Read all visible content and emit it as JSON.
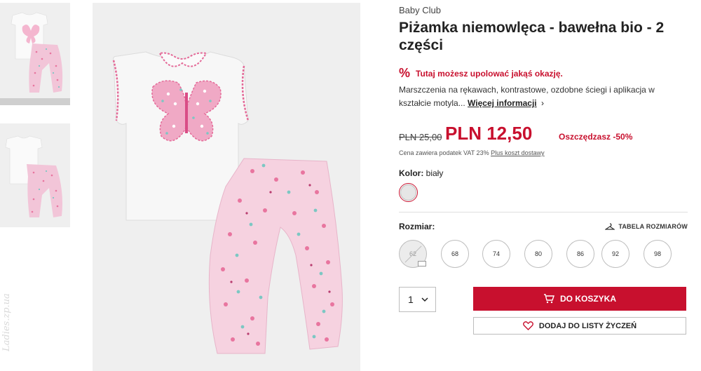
{
  "product": {
    "brand": "Baby Club",
    "title": "Piżamka niemowlęca - bawełna bio - 2 części",
    "promo_icon": "%",
    "promo_text": "Tutaj możesz upolować jakąś okazję.",
    "description": "Marszczenia na rękawach, kontrastowe, ozdobne ściegi i aplikacja w kształcie motyla...",
    "more_link": "Więcej informacji",
    "more_chevron": "›",
    "old_price": "PLN 25,00",
    "new_price": "PLN 12,50",
    "savings": "Oszczędzasz -50%",
    "vat_text": "Cena zawiera podatek VAT 23%",
    "shipping_link": "Plus koszt dostawy"
  },
  "color": {
    "label": "Kolor:",
    "value": "biały",
    "swatch_color": "#e6e6e6"
  },
  "sizes": {
    "label": "Rozmiar:",
    "table_link": "TABELA ROZMIARÓW",
    "options": [
      {
        "label": "62",
        "available": false
      },
      {
        "label": "68",
        "available": true
      },
      {
        "label": "74",
        "available": true
      },
      {
        "label": "80",
        "available": true
      },
      {
        "label": "86",
        "available": true
      },
      {
        "label": "92",
        "available": true
      },
      {
        "label": "98",
        "available": true
      }
    ]
  },
  "actions": {
    "quantity": "1",
    "add_to_cart": "DO KOSZYKA",
    "add_to_wishlist": "DODAJ DO LISTY ŻYCZEŃ"
  },
  "watermark": "Ladies.zp.ua",
  "colors": {
    "accent": "#c8102e",
    "image_bg": "#efefef"
  }
}
